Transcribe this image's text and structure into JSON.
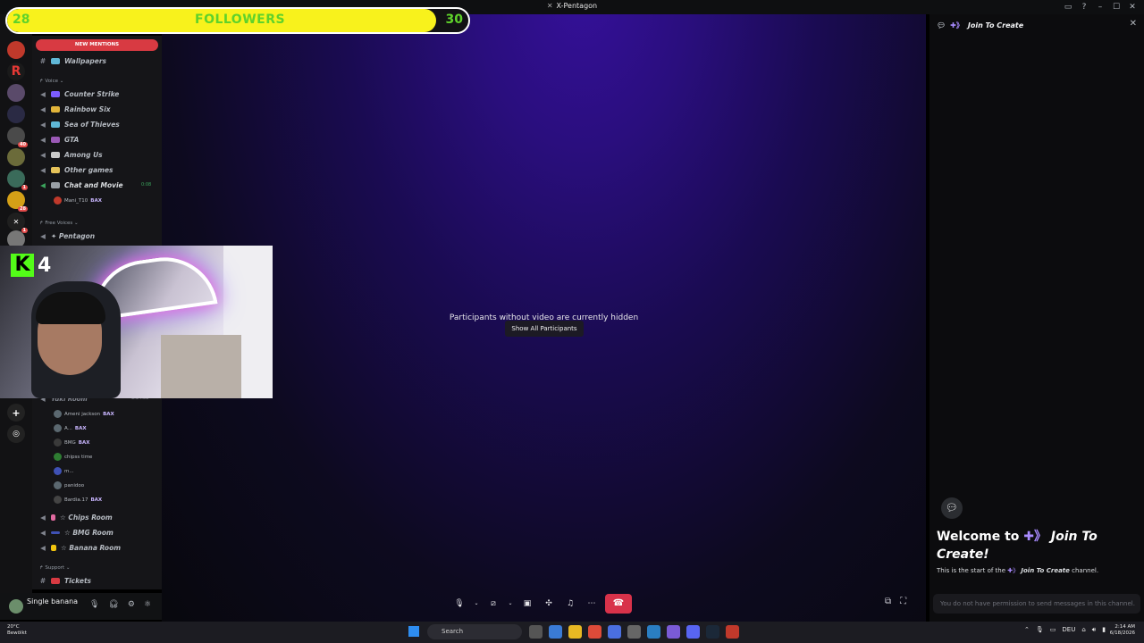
{
  "window": {
    "title": "X-Pentagon"
  },
  "overlay": {
    "followers_current": "28",
    "followers_label": "FOLLOWERS",
    "followers_goal": "30",
    "followers_progress": 0.93,
    "kick_count": "4",
    "accent_color": "#f8f21c",
    "text_color": "#5fd22b"
  },
  "servers": [
    {
      "label": "",
      "badge": ""
    },
    {
      "label": "R",
      "badge": ""
    },
    {
      "label": "",
      "badge": ""
    },
    {
      "label": "",
      "badge": ""
    },
    {
      "label": "",
      "badge": "40"
    },
    {
      "label": "",
      "badge": ""
    },
    {
      "label": "",
      "badge": "1"
    },
    {
      "label": "",
      "badge": "28"
    },
    {
      "label": "",
      "badge": "1"
    },
    {
      "label": "",
      "badge": ""
    }
  ],
  "sidebar": {
    "new_mentions": "NEW MENTIONS",
    "wallpapers": "Wallpapers",
    "voice_category": "Voice",
    "voice_channels": [
      {
        "name": "Counter Strike",
        "color": "#7b5cff"
      },
      {
        "name": "Rainbow Six",
        "color": "#e1b43a"
      },
      {
        "name": "Sea of Thieves",
        "color": "#5fb7d6"
      },
      {
        "name": "GTA",
        "color": "#9b59b6"
      },
      {
        "name": "Among Us",
        "color": "#c9c9c9"
      },
      {
        "name": "Other games",
        "color": "#e6c35a"
      },
      {
        "name": "Chat and Movie",
        "color": "#9aa0a6"
      }
    ],
    "chat_timer": "0:08",
    "chat_user": {
      "name": "Mani_T10",
      "tag": "BAX"
    },
    "free_voices_category": "Free Voices",
    "pentagon_channel": "✦ Pentagon",
    "room_timer": "3:34:08",
    "room_partial": "Yuki Room",
    "room_users": [
      {
        "name": "Ameni jackson",
        "tag": "BAX"
      },
      {
        "name": "A...",
        "tag": "BAX"
      },
      {
        "name": "BMG",
        "tag": "BAX"
      },
      {
        "name": "chipss time",
        "tag": ""
      },
      {
        "name": "m...",
        "tag": ""
      },
      {
        "name": "panidoo",
        "tag": ""
      },
      {
        "name": "Bardia.17",
        "tag": "BAX"
      }
    ],
    "rooms": [
      "☆ Chips Room",
      "☆ BMG Room",
      "☆ Banana Room"
    ],
    "support_category": "Support",
    "tickets": "Tickets"
  },
  "user_panel": {
    "name": "Single banana"
  },
  "stage": {
    "hidden_message": "Participants without video are currently hidden",
    "show_all_label": "Show All Participants"
  },
  "right_panel": {
    "header": "Join To Create",
    "welcome_prefix": "Welcome to ",
    "welcome_channel": "Join To Create!",
    "start_prefix": "This is the start of the ",
    "start_channel": "Join To Create",
    "start_suffix": " channel.",
    "no_permission": "You do not have permission to send messages in this channel."
  },
  "taskbar": {
    "weather_temp": "20°C",
    "weather_desc": "Bewölkt",
    "search_placeholder": "Search",
    "lang": "DEU",
    "time": "2:14 AM",
    "date": "6/18/2026"
  }
}
